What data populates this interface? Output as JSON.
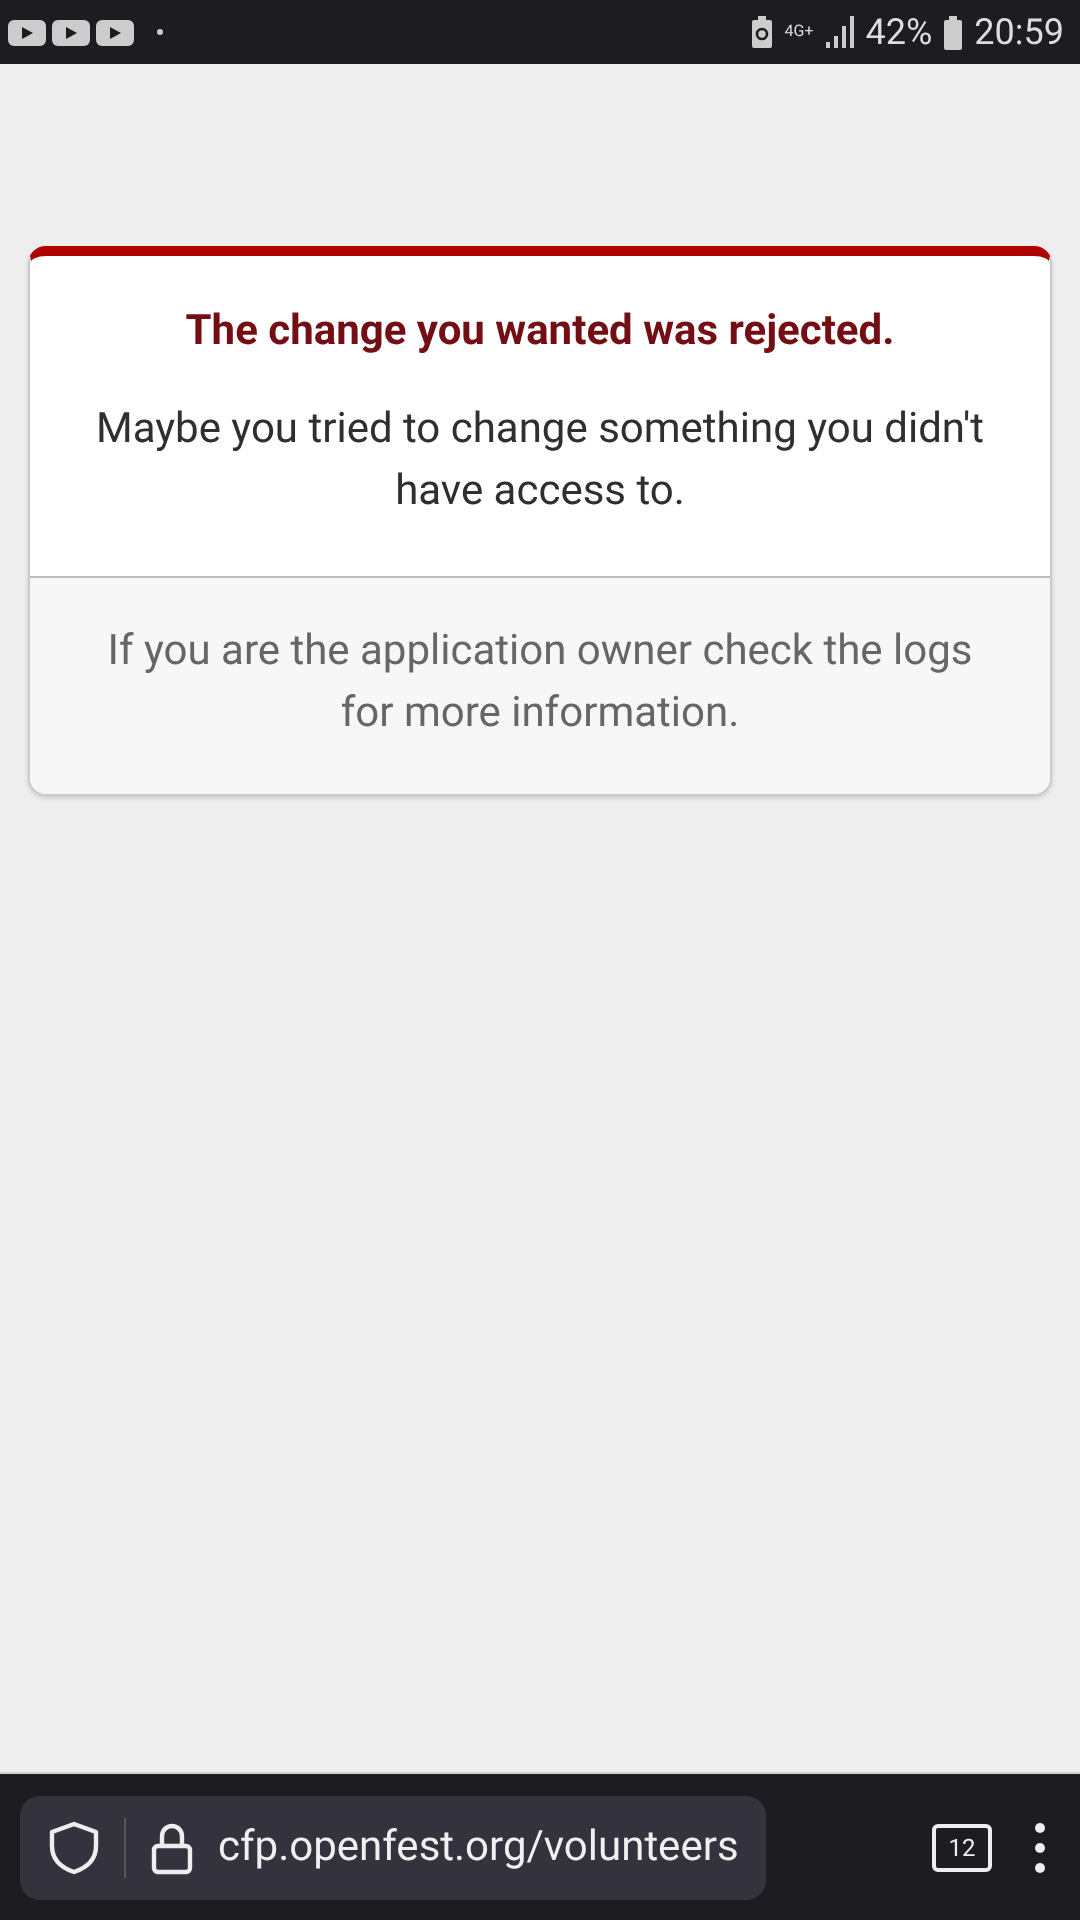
{
  "status_bar": {
    "network": "4G+",
    "battery": "42%",
    "time": "20:59"
  },
  "error": {
    "title": "The change you wanted was rejected.",
    "message": "Maybe you tried to change something you didn't have access to.",
    "footer": "If you are the application owner check the logs for more information."
  },
  "browser_bar": {
    "url": "cfp.openfest.org/volunteers",
    "tab_count": "12"
  }
}
